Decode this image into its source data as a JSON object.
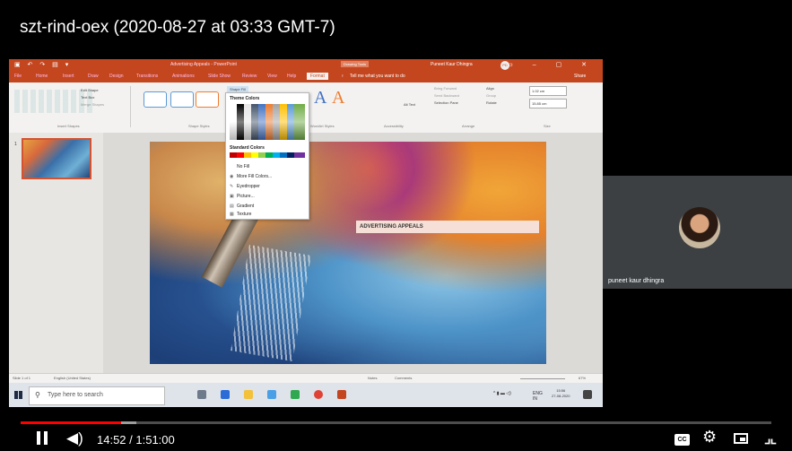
{
  "video": {
    "title": "szt-rind-oex (2020-08-27 at 03:33 GMT-7)",
    "current_time": "14:52",
    "duration": "1:51:00",
    "time_display": "14:52 / 1:51:00",
    "progress_fraction": 0.134,
    "buffered_fraction": 0.02
  },
  "controls": {
    "play_icon": "pause-icon",
    "volume_icon": "volume-icon",
    "cc_label": "CC",
    "settings_icon": "gear-icon",
    "miniplayer_icon": "miniplayer-icon",
    "fullscreen_icon": "exit-fullscreen-icon"
  },
  "participant": {
    "name": "puneet kaur dhingra"
  },
  "powerpoint": {
    "doc_title": "Advertising Appeals - PowerPoint",
    "context_tab": "Drawing Tools",
    "user_name": "Puneet Kaur Dhingra",
    "user_initials": "PD",
    "tabs": [
      "File",
      "Home",
      "Insert",
      "Draw",
      "Design",
      "Transitions",
      "Animations",
      "Slide Show",
      "Review",
      "View",
      "Help",
      "Format"
    ],
    "tell_me": "Tell me what you want to do",
    "share": "Share",
    "ribbon": {
      "edit_shape": "Edit Shape",
      "text_box": "Text Box",
      "merge_shapes": "Merge Shapes",
      "insert_shapes": "Insert Shapes",
      "shape_styles": "Shape Styles",
      "wordart_styles": "WordArt Styles",
      "accessibility": "Accessibility",
      "alt_text": "Alt Text",
      "bring_forward": "Bring Forward",
      "send_backward": "Send Backward",
      "selection_pane": "Selection Pane",
      "align": "Align",
      "group": "Group",
      "rotate": "Rotate",
      "arrange": "Arrange",
      "size": "Size",
      "height": "1.02 cm",
      "width": "15.85 cm",
      "shape_fill": "Shape Fill"
    },
    "fill_menu": {
      "theme_colors": "Theme Colors",
      "standard_colors": "Standard Colors",
      "no_fill": "No Fill",
      "more_fill": "More Fill Colors...",
      "eyedropper": "Eyedropper",
      "picture": "Picture...",
      "gradient": "Gradient",
      "texture": "Texture"
    },
    "slide_number": "1",
    "slide_banner": "ADVERTISING APPEALS",
    "status": {
      "slide_of": "Slide 1 of 1",
      "language": "English (United States)",
      "notes": "Notes",
      "comments": "Comments",
      "zoom": "67%"
    },
    "taskbar": {
      "search_placeholder": "Type here to search",
      "lang": "ENG",
      "region": "IN",
      "time": "15:56",
      "date": "27-08-2020"
    }
  }
}
